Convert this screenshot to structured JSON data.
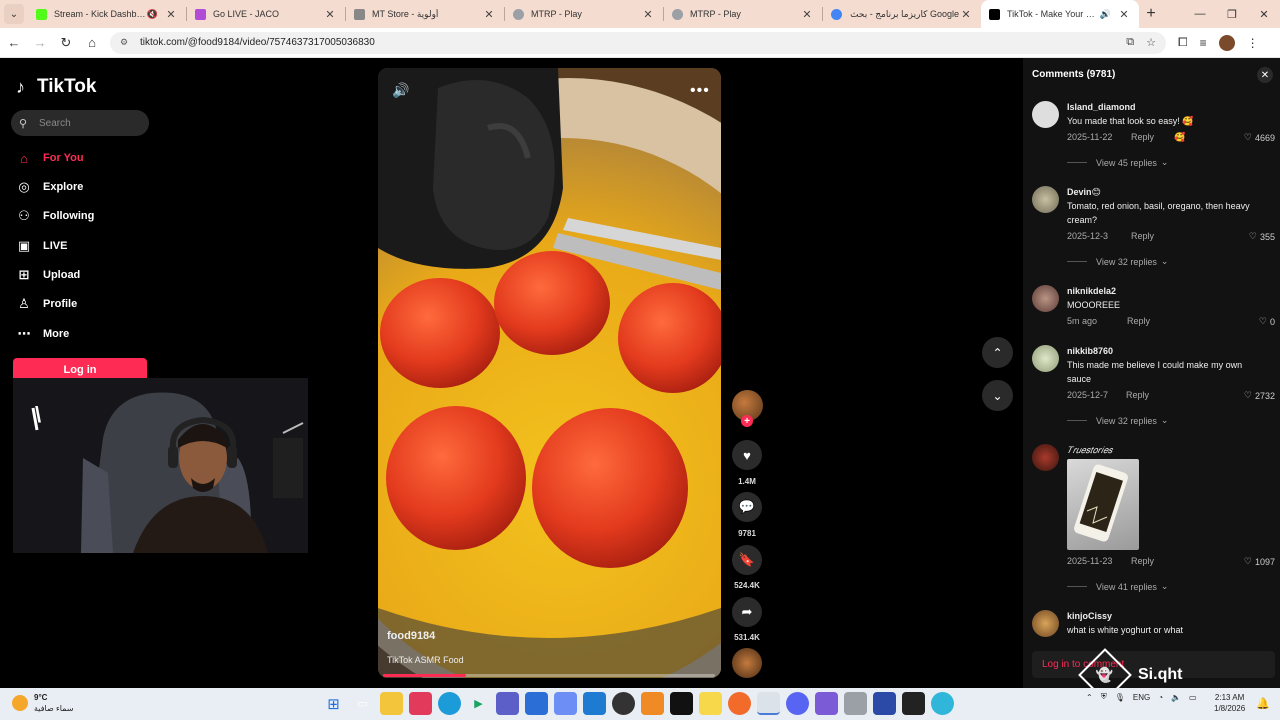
{
  "browser": {
    "tabs": [
      {
        "title": "Stream - Kick Dashboard",
        "color": "#53fc18",
        "muted": true
      },
      {
        "title": "Go LIVE - JACO",
        "color": "#b14cd6",
        "muted": false
      },
      {
        "title": "MT Store - أولوية",
        "color": "#888888",
        "muted": false
      },
      {
        "title": "MTRP - Play",
        "color": "#9aa0a6",
        "muted": false
      },
      {
        "title": "MTRP - Play",
        "color": "#9aa0a6",
        "muted": false
      },
      {
        "title": "كاريزما برنامج - بحث Google",
        "color": "#4285f4",
        "muted": false
      },
      {
        "title": "TikTok - Make Your Day",
        "color": "#000000",
        "muted": true,
        "active": true
      }
    ],
    "url": "tiktok.com/@food9184/video/7574637317005036830"
  },
  "tiktok": {
    "brand": "TikTok",
    "search_placeholder": "Search",
    "nav": [
      {
        "label": "For You",
        "icon": "home-icon",
        "selected": true
      },
      {
        "label": "Explore",
        "icon": "compass-icon"
      },
      {
        "label": "Following",
        "icon": "following-icon"
      },
      {
        "label": "LIVE",
        "icon": "live-icon"
      },
      {
        "label": "Upload",
        "icon": "upload-icon"
      },
      {
        "label": "Profile",
        "icon": "profile-icon"
      },
      {
        "label": "More",
        "icon": "more-icon"
      }
    ],
    "login_label": "Log in",
    "webcam_mark": "\\",
    "video": {
      "username": "food9184",
      "description": "TikTok ASMR Food",
      "progress": 0.25
    },
    "actions": {
      "likes": "1.4M",
      "comments": "9781",
      "saves": "524.4K",
      "shares": "531.4K"
    },
    "comments_header": "Comments (9781)",
    "comments": [
      {
        "user": "Island_diamond",
        "text": "You made that look so easy! 🥰",
        "date": "2025-11-22",
        "reply": "Reply",
        "likes": "4669",
        "view_replies": "View 45 replies"
      },
      {
        "user": "Devin😊",
        "text": "Tomato, red onion, basil, oregano, then heavy cream?",
        "date": "2025-12-3",
        "reply": "Reply",
        "likes": "355",
        "view_replies": "View 32 replies"
      },
      {
        "user": "niknikdela2",
        "text": "MOOOREEE",
        "date": "5m ago",
        "reply": "Reply",
        "likes": "0",
        "view_replies": ""
      },
      {
        "user": "nikkib8760",
        "text": "This made me believe I could make my own sauce",
        "date": "2025-12-7",
        "reply": "Reply",
        "likes": "2732",
        "view_replies": "View 32 replies"
      },
      {
        "user": "𝑇𝑟𝑢𝑒𝑠𝑡𝑜𝑟𝑖𝑒𝑠",
        "text": "",
        "date": "2025-11-23",
        "reply": "Reply",
        "likes": "1097",
        "view_replies": "View 41 replies"
      },
      {
        "user": "kinjoCissy",
        "text": "what is white yoghurt or what",
        "date": "",
        "reply": "",
        "likes": "",
        "view_replies": ""
      }
    ],
    "comments_login": "Log in to comment"
  },
  "watermark": "Si.qht",
  "taskbar": {
    "weather_temp": "9°C",
    "weather_desc": "سماء صافية",
    "lang": "ENG",
    "time": "2:13 AM",
    "date": "1/8/2026"
  }
}
